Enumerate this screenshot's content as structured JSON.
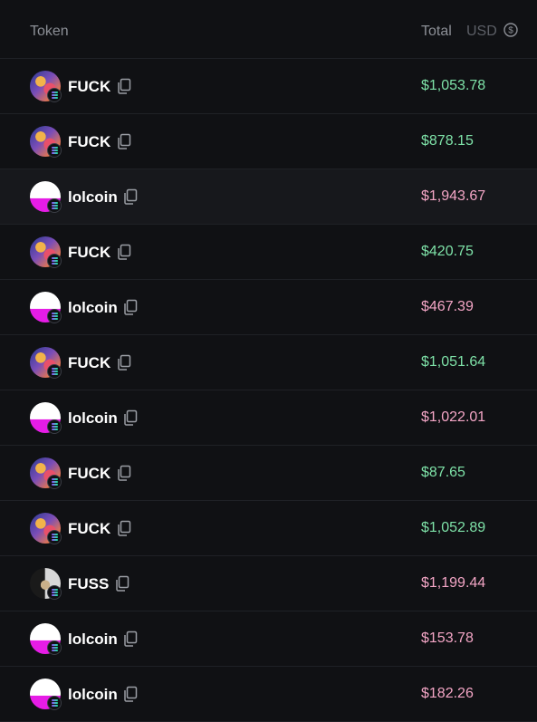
{
  "header": {
    "token_label": "Token",
    "total_label": "Total",
    "currency_label": "USD",
    "swap_icon": "currency-swap-icon"
  },
  "colors": {
    "positive": "#7ee2a8",
    "negative": "#f4a6c6"
  },
  "rows": [
    {
      "token": "FUCK",
      "avatar": "fuck",
      "value": "$1,053.78",
      "trend": "positive"
    },
    {
      "token": "FUCK",
      "avatar": "fuck",
      "value": "$878.15",
      "trend": "positive"
    },
    {
      "token": "lolcoin",
      "avatar": "lol",
      "value": "$1,943.67",
      "trend": "negative"
    },
    {
      "token": "FUCK",
      "avatar": "fuck",
      "value": "$420.75",
      "trend": "positive"
    },
    {
      "token": "lolcoin",
      "avatar": "lol",
      "value": "$467.39",
      "trend": "negative"
    },
    {
      "token": "FUCK",
      "avatar": "fuck",
      "value": "$1,051.64",
      "trend": "positive"
    },
    {
      "token": "lolcoin",
      "avatar": "lol",
      "value": "$1,022.01",
      "trend": "negative"
    },
    {
      "token": "FUCK",
      "avatar": "fuck",
      "value": "$87.65",
      "trend": "positive"
    },
    {
      "token": "FUCK",
      "avatar": "fuck",
      "value": "$1,052.89",
      "trend": "positive"
    },
    {
      "token": "FUSS",
      "avatar": "fuss",
      "value": "$1,199.44",
      "trend": "negative"
    },
    {
      "token": "lolcoin",
      "avatar": "lol",
      "value": "$153.78",
      "trend": "negative"
    },
    {
      "token": "lolcoin",
      "avatar": "lol",
      "value": "$182.26",
      "trend": "negative"
    }
  ]
}
